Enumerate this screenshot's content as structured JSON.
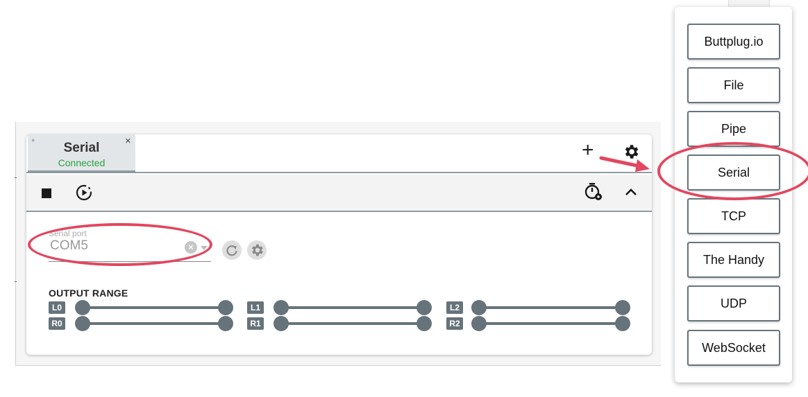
{
  "tab": {
    "title": "Serial",
    "status": "Connected",
    "close": "×"
  },
  "header": {
    "add_icon": "plus-icon",
    "settings_icon": "gear-icon"
  },
  "toolbar": {
    "stop_icon": "stop-icon",
    "play_timer_icon": "play-timer-icon",
    "timer_settings_icon": "timer-settings-icon",
    "collapse_icon": "chevron-up-icon"
  },
  "serial_port": {
    "label": "Serial port",
    "value": "COM5"
  },
  "output_range": {
    "label": "OUTPUT RANGE",
    "channels": [
      "L0",
      "R0",
      "L1",
      "R1",
      "L2",
      "R2"
    ]
  },
  "menu": {
    "items": [
      "Buttplug.io",
      "File",
      "Pipe",
      "Serial",
      "TCP",
      "The Handy",
      "UDP",
      "WebSocket"
    ]
  },
  "colors": {
    "accent": "#66737b",
    "status_connected": "#27a244",
    "annotation": "#e14760"
  }
}
